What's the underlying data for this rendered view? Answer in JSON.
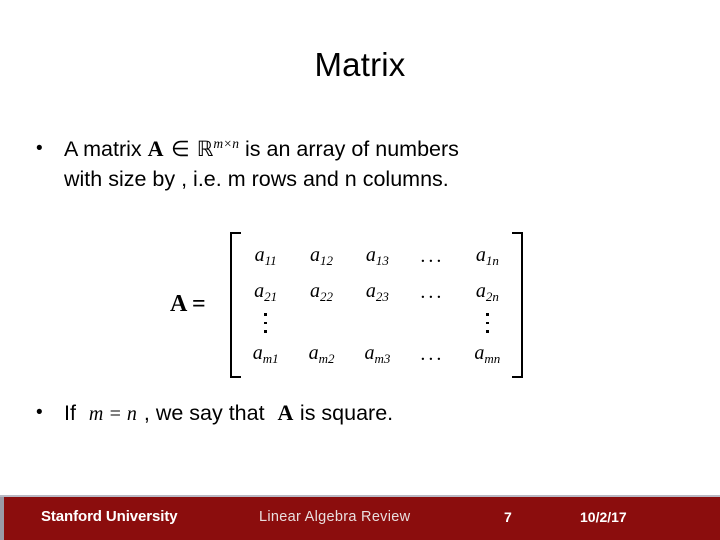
{
  "slide": {
    "title": "Matrix",
    "bullet_marker": "•"
  },
  "bullets": [
    {
      "id": "bullet-1",
      "line1_pre": "A matrix ",
      "math_A": "A",
      "math_in": "∈",
      "math_R": "ℝ",
      "math_sup": "m×n",
      "line1_post": " is an array of numbers",
      "line2": "with size  by , i.e.  m rows and n columns."
    },
    {
      "id": "bullet-2",
      "pre": "If ",
      "math_eq": "m = n",
      "mid": ", we say that ",
      "math_A": "A",
      "post": " is square."
    }
  ],
  "matrix": {
    "lhs_symbol": "A",
    "lhs_equals": "=",
    "bracket_left": "[",
    "bracket_right": "]",
    "rows": [
      [
        "a",
        "a",
        "a",
        "...",
        "a"
      ],
      [
        "a",
        "a",
        "a",
        "...",
        "a"
      ],
      [
        "⋮",
        "",
        "",
        "",
        "⋮"
      ],
      [
        "a",
        "a",
        "a",
        "...",
        "a"
      ]
    ],
    "subscripts": [
      [
        "11",
        "12",
        "13",
        "",
        "1n"
      ],
      [
        "21",
        "22",
        "23",
        "",
        "2n"
      ],
      [
        "",
        "",
        "",
        "",
        ""
      ],
      [
        "m1",
        "m2",
        "m3",
        "",
        "mn"
      ]
    ],
    "ellipsis": "...",
    "row_count": 4,
    "column_count": 5
  },
  "footer": {
    "organization": "Stanford University",
    "subject": "Linear Algebra Review",
    "page_number": "7",
    "date": "10/2/17",
    "background_color": "#8B0D0D",
    "text_color": "#ffffff"
  }
}
